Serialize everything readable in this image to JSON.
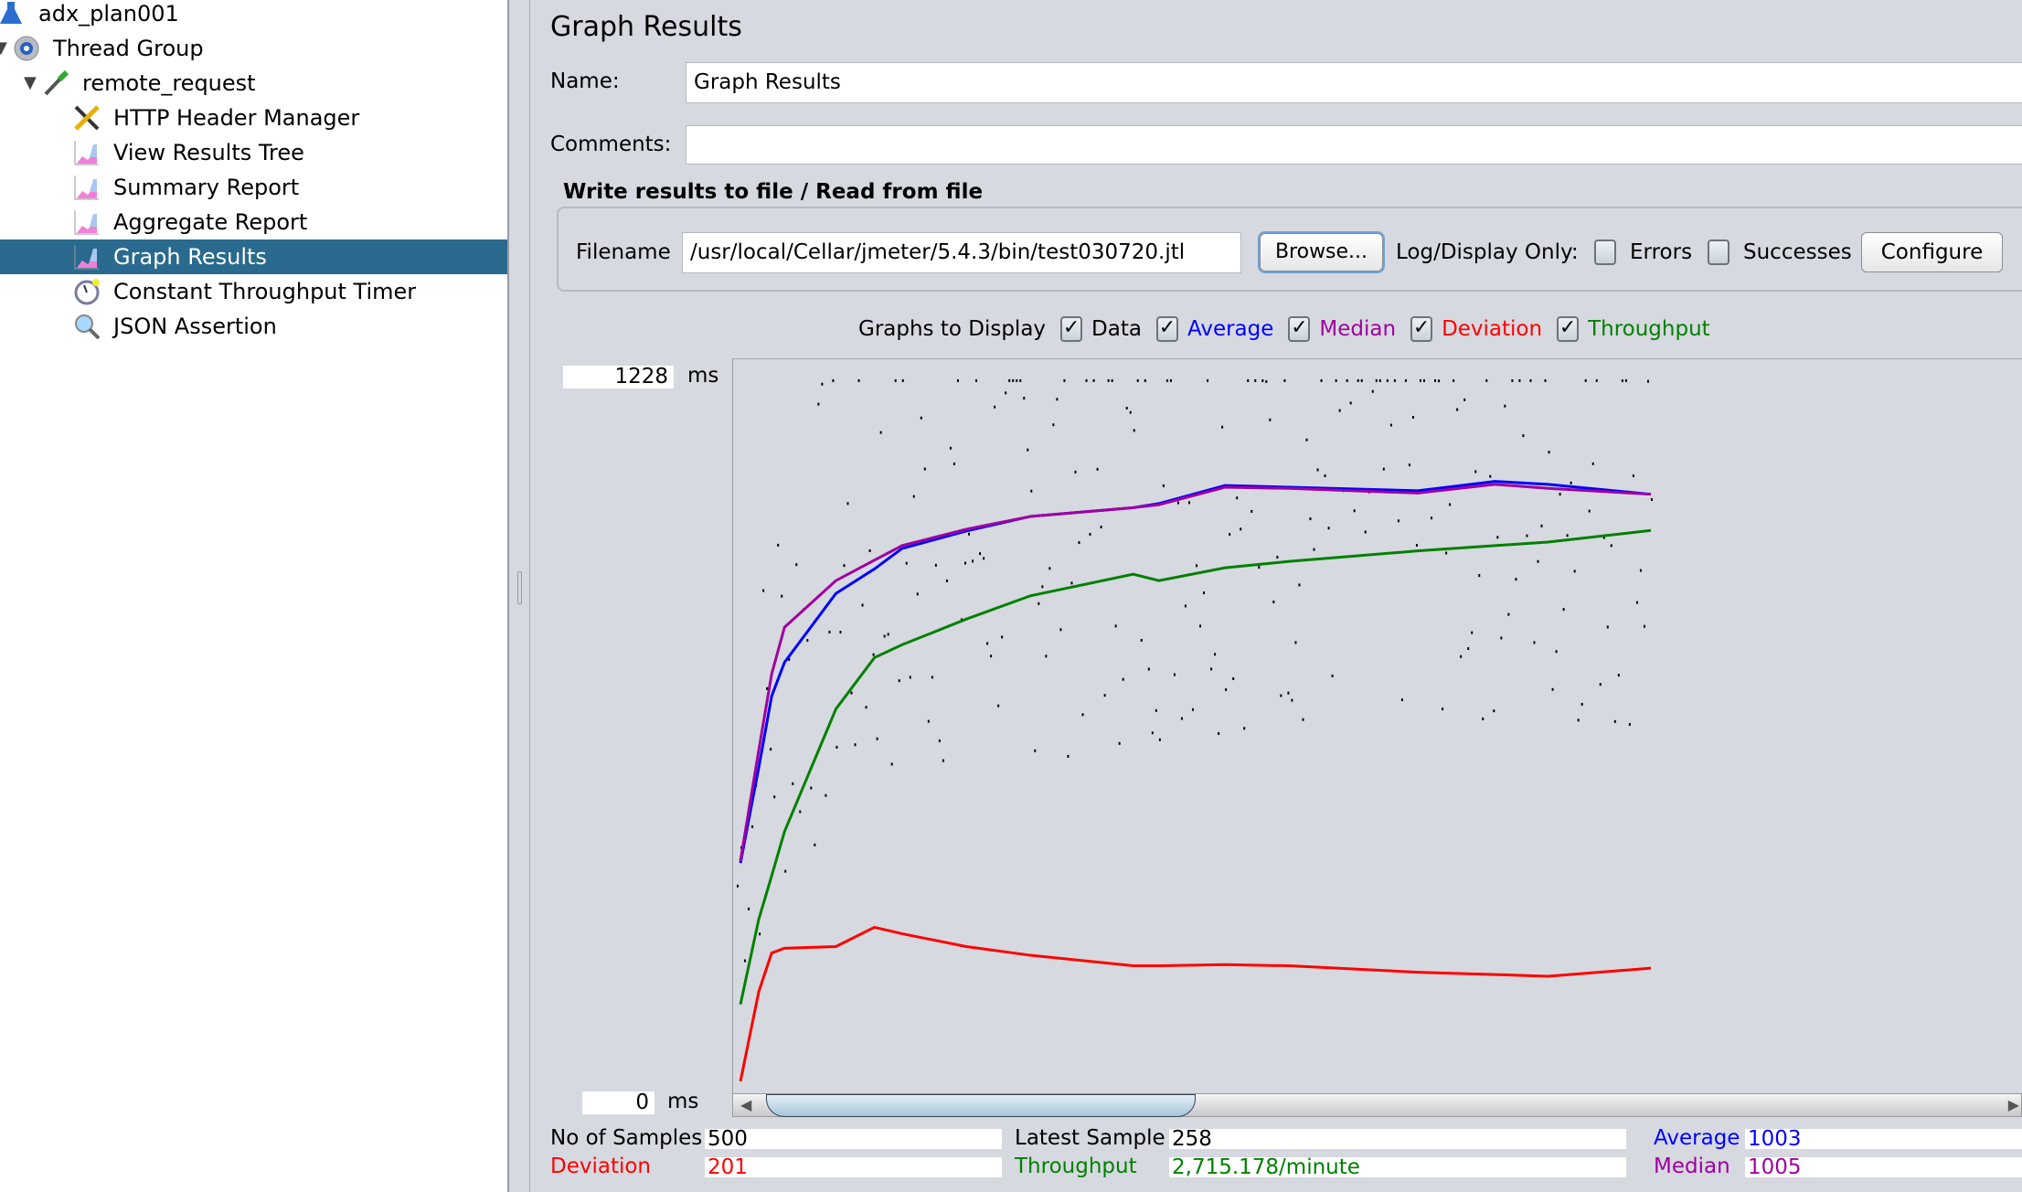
{
  "tree": [
    {
      "label": "adx_plan001",
      "icon": "test-plan-flask-icon",
      "level": 0
    },
    {
      "label": "Thread Group",
      "icon": "gear-icon",
      "level": 1,
      "expanded": true
    },
    {
      "label": "remote_request",
      "icon": "pipette-sampler-icon",
      "level": 2,
      "expanded": true
    },
    {
      "label": "HTTP Header Manager",
      "icon": "wrench-screwdriver-icon",
      "level": 3
    },
    {
      "label": "View Results Tree",
      "icon": "graph-listener-icon",
      "level": 3
    },
    {
      "label": "Summary Report",
      "icon": "graph-listener-icon",
      "level": 3
    },
    {
      "label": "Aggregate Report",
      "icon": "graph-listener-icon",
      "level": 3
    },
    {
      "label": "Graph Results",
      "icon": "graph-listener-icon",
      "level": 3,
      "selected": true
    },
    {
      "label": "Constant Throughput Timer",
      "icon": "timer-clock-icon",
      "level": 3
    },
    {
      "label": "JSON Assertion",
      "icon": "magnifier-icon",
      "level": 3
    }
  ],
  "panel": {
    "title": "Graph Results",
    "name_label": "Name:",
    "name_value": "Graph Results",
    "comments_label": "Comments:",
    "comments_value": "",
    "file_section": "Write results to file / Read from file",
    "filename_label": "Filename",
    "filename_value": "/usr/local/Cellar/jmeter/5.4.3/bin/test030720.jtl",
    "browse": "Browse...",
    "log_display": "Log/Display Only:",
    "errors": "Errors",
    "errors_checked": false,
    "successes": "Successes",
    "successes_checked": false,
    "configure": "Configure"
  },
  "graphs": {
    "label": "Graphs to Display",
    "options": [
      {
        "label": "Data",
        "checked": true,
        "color": "#000000"
      },
      {
        "label": "Average",
        "checked": true,
        "color": "#0000ff"
      },
      {
        "label": "Median",
        "checked": true,
        "color": "#a000a0"
      },
      {
        "label": "Deviation",
        "checked": true,
        "color": "#ff0000"
      },
      {
        "label": "Throughput",
        "checked": true,
        "color": "#008000"
      }
    ],
    "ymax_label": "1228",
    "ymin_label": "0",
    "unit": "ms"
  },
  "chart_data": {
    "type": "scatter",
    "ylim": [
      0,
      1228
    ],
    "x_unit": "sample",
    "series": [
      {
        "name": "Average",
        "color": "#0000ff",
        "x": [
          4,
          14,
          21,
          28,
          56,
          77,
          92,
          127,
          162,
          218,
          232,
          268,
          303,
          373,
          415,
          444,
          500
        ],
        "values": [
          396,
          560,
          682,
          740,
          858,
          900,
          935,
          965,
          990,
          1005,
          1012,
          1043,
          1040,
          1034,
          1050,
          1045,
          1028
        ]
      },
      {
        "name": "Median",
        "color": "#a000a0",
        "x": [
          4,
          14,
          21,
          28,
          56,
          77,
          92,
          127,
          162,
          218,
          232,
          268,
          303,
          373,
          415,
          444,
          500
        ],
        "values": [
          400,
          590,
          720,
          800,
          880,
          915,
          940,
          968,
          990,
          1005,
          1010,
          1040,
          1038,
          1030,
          1045,
          1038,
          1028
        ]
      },
      {
        "name": "Throughput",
        "color": "#008000",
        "x": [
          4,
          14,
          21,
          28,
          56,
          77,
          92,
          127,
          162,
          218,
          232,
          268,
          303,
          373,
          415,
          444,
          500
        ],
        "values": [
          154,
          300,
          374,
          450,
          660,
          748,
          770,
          814,
          854,
          891,
          880,
          902,
          913,
          931,
          940,
          946,
          966
        ]
      },
      {
        "name": "Deviation",
        "color": "#ff0000",
        "x": [
          4,
          14,
          21,
          28,
          56,
          77,
          92,
          127,
          162,
          218,
          232,
          268,
          303,
          373,
          415,
          444,
          500
        ],
        "values": [
          22,
          176,
          242,
          250,
          253,
          286,
          275,
          253,
          238,
          220,
          220,
          222,
          220,
          209,
          205,
          202,
          216
        ]
      }
    ]
  },
  "stats": {
    "samples_label": "No of Samples",
    "samples": "500",
    "latest_label": "Latest Sample",
    "latest": "258",
    "average_label": "Average",
    "average": "1003",
    "deviation_label": "Deviation",
    "deviation": "201",
    "throughput_label": "Throughput",
    "throughput": "2,715.178/minute",
    "median_label": "Median",
    "median": "1005"
  }
}
